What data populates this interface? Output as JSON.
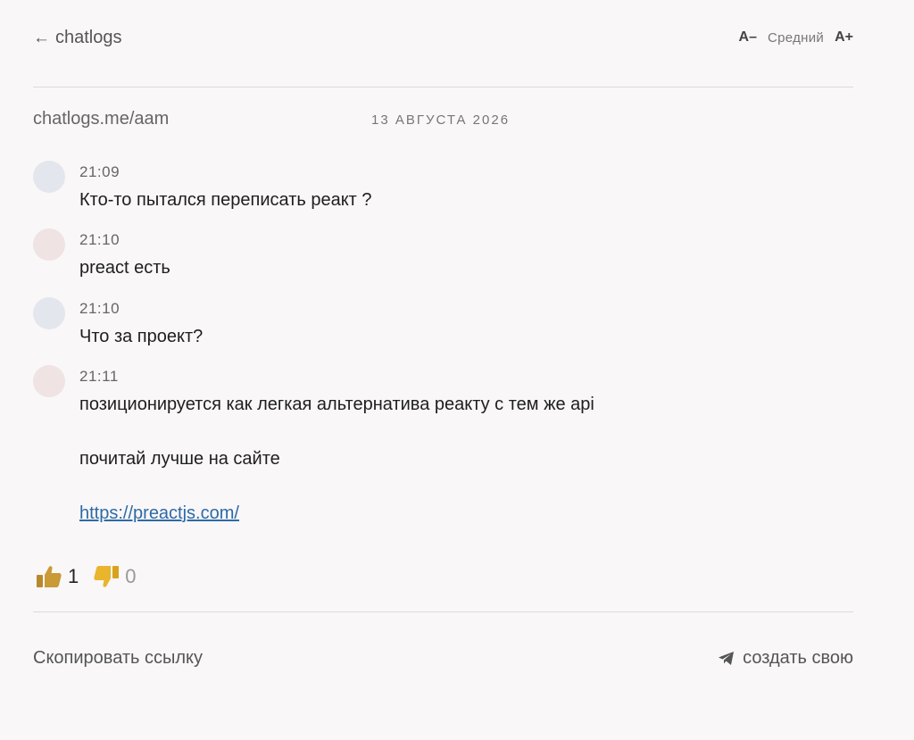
{
  "header": {
    "back_label": "chatlogs",
    "font_decrease": "A–",
    "font_size_label": "Средний",
    "font_increase": "A+"
  },
  "meta": {
    "url": "chatlogs.me/aam",
    "date": "13 АВГУСТА 2026"
  },
  "messages": [
    {
      "time": "21:09",
      "text": "Кто-то пытался переписать реакт ?",
      "avatar_color": "#e3e6ed"
    },
    {
      "time": "21:10",
      "text": "preact есть",
      "avatar_color": "#efe3e3"
    },
    {
      "time": "21:10",
      "text": "Что за проект?",
      "avatar_color": "#e3e6ed"
    },
    {
      "time": "21:11",
      "paragraphs": [
        "позиционируется как легкая альтернатива реакту с тем же api",
        "почитай лучше на сайте"
      ],
      "link": "https://preactjs.com/",
      "avatar_color": "#efe3e3"
    }
  ],
  "reactions": {
    "likes": "1",
    "dislikes": "0",
    "like_icon": "thumbs-up-icon",
    "dislike_icon": "thumbs-down-icon"
  },
  "footer": {
    "copy_link": "Скопировать ссылку",
    "create_own": "создать свою",
    "create_icon": "telegram-icon"
  },
  "colors": {
    "link": "#2d6aa8",
    "like": "#c99a35",
    "dislike": "#e8b52d"
  }
}
